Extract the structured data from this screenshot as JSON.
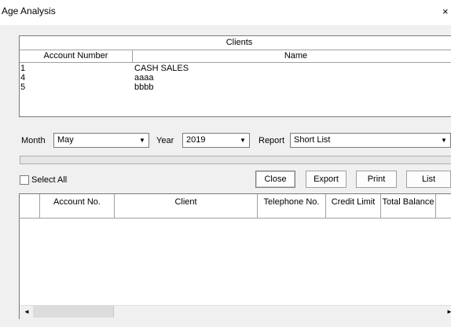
{
  "window": {
    "title": "Age Analysis",
    "close_glyph": "×"
  },
  "clients": {
    "caption": "Clients",
    "columns": [
      "Account Number",
      "Name"
    ],
    "rows": [
      {
        "account": "1",
        "name": "CASH SALES"
      },
      {
        "account": "4",
        "name": "aaaa"
      },
      {
        "account": "5",
        "name": "bbbb"
      }
    ]
  },
  "filters": {
    "month_label": "Month",
    "month_value": "May",
    "year_label": "Year",
    "year_value": "2019",
    "report_label": "Report",
    "report_value": "Short List"
  },
  "select_all_label": "Select All",
  "buttons": {
    "close": "Close",
    "export": "Export",
    "print": "Print",
    "list": "List"
  },
  "grid": {
    "columns": [
      "",
      "Account No.",
      "Client",
      "Telephone No.",
      "Credit Limit",
      "Total Balance",
      ""
    ]
  },
  "icons": {
    "dropdown_arrow": "▼",
    "scroll_left": "◄",
    "scroll_right": "►"
  }
}
